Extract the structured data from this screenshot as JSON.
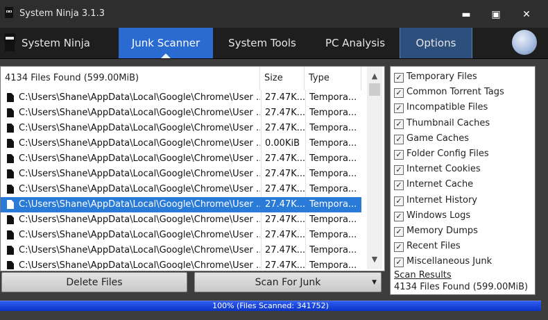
{
  "window": {
    "title": "System Ninja 3.1.3",
    "controls": {
      "minimize": "▬",
      "maximize": "▣",
      "close": "✕"
    }
  },
  "nav": {
    "tabs": [
      {
        "label": "System Ninja"
      },
      {
        "label": "Junk Scanner"
      },
      {
        "label": "System Tools"
      },
      {
        "label": "PC Analysis"
      },
      {
        "label": "Options"
      }
    ],
    "active_tab": "Junk Scanner"
  },
  "file_list": {
    "headers": {
      "name": "4134 Files Found (599.00MiB)",
      "size": "Size",
      "type": "Type"
    },
    "rows": [
      {
        "path": "C:\\Users\\Shane\\AppData\\Local\\Google\\Chrome\\User ...",
        "size": "27.47K...",
        "type": "Tempora..."
      },
      {
        "path": "C:\\Users\\Shane\\AppData\\Local\\Google\\Chrome\\User ...",
        "size": "27.47K...",
        "type": "Tempora..."
      },
      {
        "path": "C:\\Users\\Shane\\AppData\\Local\\Google\\Chrome\\User ...",
        "size": "27.47K...",
        "type": "Tempora..."
      },
      {
        "path": "C:\\Users\\Shane\\AppData\\Local\\Google\\Chrome\\User ...",
        "size": "0.00KiB",
        "type": "Tempora..."
      },
      {
        "path": "C:\\Users\\Shane\\AppData\\Local\\Google\\Chrome\\User ...",
        "size": "27.47K...",
        "type": "Tempora..."
      },
      {
        "path": "C:\\Users\\Shane\\AppData\\Local\\Google\\Chrome\\User ...",
        "size": "27.47K...",
        "type": "Tempora..."
      },
      {
        "path": "C:\\Users\\Shane\\AppData\\Local\\Google\\Chrome\\User ...",
        "size": "27.47K...",
        "type": "Tempora..."
      },
      {
        "path": "C:\\Users\\Shane\\AppData\\Local\\Google\\Chrome\\User ...",
        "size": "27.47K...",
        "type": "Tempora..."
      },
      {
        "path": "C:\\Users\\Shane\\AppData\\Local\\Google\\Chrome\\User ...",
        "size": "27.47K...",
        "type": "Tempora..."
      },
      {
        "path": "C:\\Users\\Shane\\AppData\\Local\\Google\\Chrome\\User ...",
        "size": "27.47K...",
        "type": "Tempora..."
      },
      {
        "path": "C:\\Users\\Shane\\AppData\\Local\\Google\\Chrome\\User ...",
        "size": "27.47K...",
        "type": "Tempora..."
      },
      {
        "path": "C:\\Users\\Shane\\AppData\\Local\\Google\\Chrome\\User ...",
        "size": "27.47K...",
        "type": "Tempora..."
      }
    ],
    "selected_row": 7
  },
  "buttons": {
    "delete": "Delete Files",
    "scan": "Scan For Junk"
  },
  "options": [
    {
      "label": "Temporary Files",
      "checked": true
    },
    {
      "label": "Common Torrent Tags",
      "checked": true
    },
    {
      "label": "Incompatible Files",
      "checked": true
    },
    {
      "label": "Thumbnail Caches",
      "checked": true
    },
    {
      "label": "Game Caches",
      "checked": true
    },
    {
      "label": "Folder Config Files",
      "checked": true
    },
    {
      "label": "Internet Cookies",
      "checked": true
    },
    {
      "label": "Internet Cache",
      "checked": true
    },
    {
      "label": "Internet History",
      "checked": true
    },
    {
      "label": "Windows Logs",
      "checked": true
    },
    {
      "label": "Memory Dumps",
      "checked": true
    },
    {
      "label": "Recent Files",
      "checked": true
    },
    {
      "label": "Miscellaneous Junk",
      "checked": true
    }
  ],
  "scan_results": {
    "title": "Scan Results",
    "text": "4134 Files Found (599.00MiB)"
  },
  "progress": {
    "value": 1.0,
    "text": "100% (Files Scanned: 341752)"
  },
  "colors": {
    "accent": "#2a6bd1",
    "selection": "#2a7bd8",
    "progress": "#1a44c8"
  }
}
